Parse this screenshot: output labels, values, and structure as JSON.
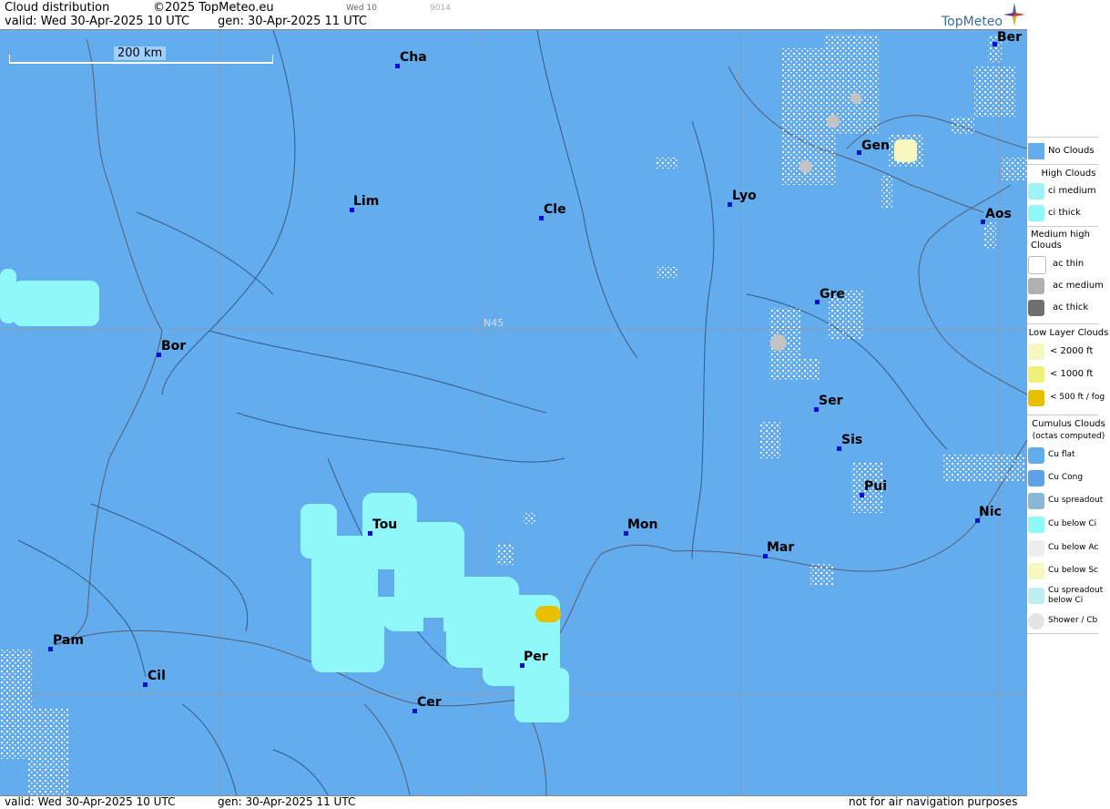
{
  "header": {
    "title": "Cloud distribution",
    "copyright": "©2025 TopMeteo.eu",
    "valid_line": "valid:  Wed  30-Apr-2025  10 UTC",
    "gen_line": "gen: 30-Apr-2025 11 UTC",
    "day_code": "Wed 10",
    "code": "9014",
    "logo": "TopMeteo"
  },
  "map": {
    "scale_label": "200 km",
    "lat_label": "N45",
    "cities": [
      {
        "name": "Cha"
      },
      {
        "name": "Ber"
      },
      {
        "name": "Gen"
      },
      {
        "name": "Lim"
      },
      {
        "name": "Cle"
      },
      {
        "name": "Lyo"
      },
      {
        "name": "Aos"
      },
      {
        "name": "Gre"
      },
      {
        "name": "Bor"
      },
      {
        "name": "Ser"
      },
      {
        "name": "Sis"
      },
      {
        "name": "Pui"
      },
      {
        "name": "Tou"
      },
      {
        "name": "Mon"
      },
      {
        "name": "Nic"
      },
      {
        "name": "Mar"
      },
      {
        "name": "Pam"
      },
      {
        "name": "Per"
      },
      {
        "name": "Cil"
      },
      {
        "name": "Cer"
      }
    ]
  },
  "legend": {
    "no_clouds": "No Clouds",
    "high_title": "High Clouds",
    "ci_medium": "ci medium",
    "ci_thick": "ci thick",
    "medium_title": "Medium high Clouds",
    "ac_thin": "ac thin",
    "ac_medium": "ac medium",
    "ac_thick": "ac thick",
    "low_title": "Low Layer Clouds",
    "low_2000": "< 2000 ft",
    "low_1000": "< 1000 ft",
    "low_500": "< 500 ft / fog",
    "cu_title": "Cumulus Clouds",
    "cu_sub": "(octas computed)",
    "cu_flat": "Cu flat",
    "cu_cong": "Cu Cong",
    "cu_spreadout": "Cu spreadout",
    "cu_below_ci": "Cu below Ci",
    "cu_below_ac": "Cu below Ac",
    "cu_below_sc": "Cu below Sc",
    "cu_spreadout_ci": "Cu spreadout below Ci",
    "shower": "Shower / Cb",
    "colors": {
      "no_clouds": "#63adef",
      "ci_medium": "#9ef4f4",
      "ci_thick": "#8ff8f8",
      "ac_thin": "#ffffff",
      "ac_medium": "#b0b0b0",
      "ac_thick": "#707070",
      "low_2000": "#f6f8c0",
      "low_1000": "#eef07a",
      "low_500": "#e8c000"
    }
  },
  "footer": {
    "valid_line": "valid:  Wed  30-Apr-2025  10 UTC",
    "gen_line": "gen: 30-Apr-2025 11 UTC",
    "disclaimer": "not for air navigation purposes"
  }
}
